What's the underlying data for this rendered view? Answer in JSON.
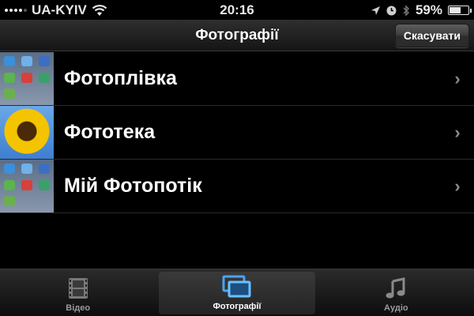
{
  "status_bar": {
    "carrier": "UA-KYIV",
    "time": "20:16",
    "battery": "59%",
    "battery_level": 0.59,
    "icons": [
      "signal-icon",
      "wifi-icon",
      "location-icon",
      "clock-icon",
      "bluetooth-icon",
      "battery-icon"
    ]
  },
  "nav": {
    "title": "Фотографії",
    "cancel_label": "Скасувати"
  },
  "list": {
    "items": [
      {
        "label": "Фотоплівка",
        "icon": "app-grid-thumbnail"
      },
      {
        "label": "Фототека",
        "icon": "sunflower-thumbnail"
      },
      {
        "label": "Мій Фотопотік",
        "icon": "app-grid-thumbnail"
      }
    ]
  },
  "tabs": [
    {
      "label": "Відео",
      "icon": "film-icon",
      "active": false
    },
    {
      "label": "Фотографії",
      "icon": "photos-icon",
      "active": true
    },
    {
      "label": "Аудіо",
      "icon": "music-note-icon",
      "active": false
    }
  ],
  "colors": {
    "accent_blue": "#4aa3f0",
    "chevron": "#8a8a8a",
    "background": "#000000"
  }
}
